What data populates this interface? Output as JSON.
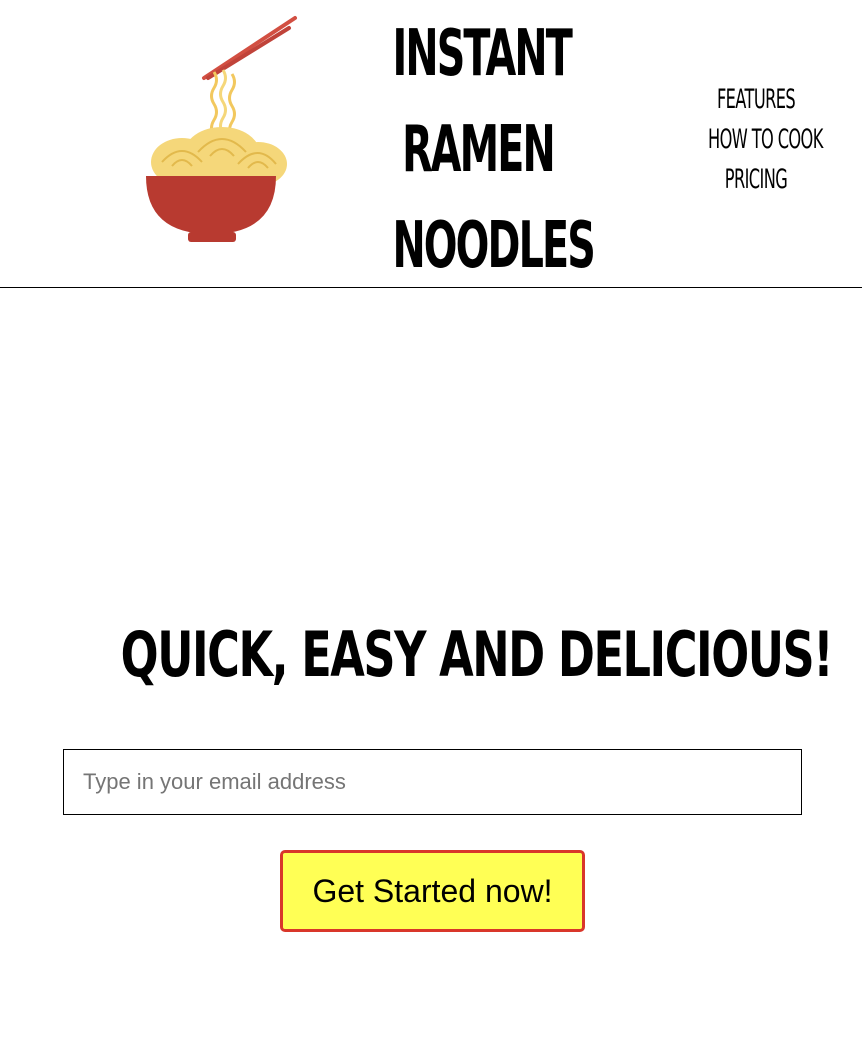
{
  "header": {
    "logo_icon": "ramen-bowl-with-chopsticks",
    "brand_lines": [
      "INSTANT",
      "RAMEN",
      "NOODLES"
    ],
    "nav": [
      "FEATURES",
      "HOW TO COOK",
      "PRICING"
    ]
  },
  "hero": {
    "title": "QUICK, EASY AND DELICIOUS!",
    "email_placeholder": "Type in your email address",
    "email_value": "",
    "cta_label": "Get Started now!"
  },
  "colors": {
    "bowl": "#b83a30",
    "noodles": "#f5d77a",
    "chopsticks": "#d24f42",
    "cta_background": "#ffff55",
    "cta_border": "#d9362a"
  }
}
